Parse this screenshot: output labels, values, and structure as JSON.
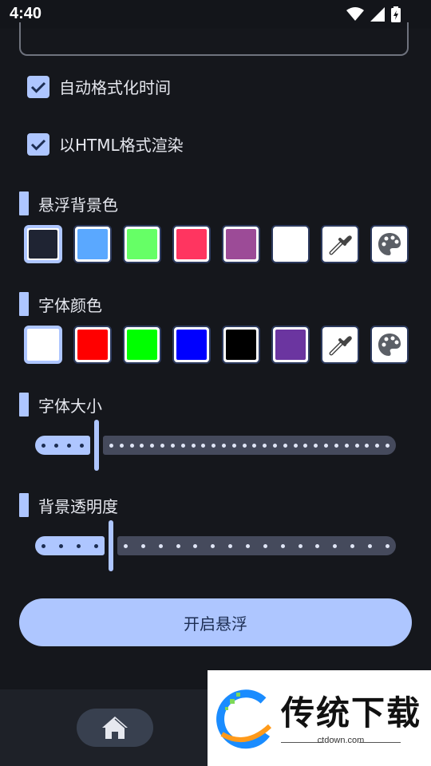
{
  "status_bar": {
    "time": "4:40"
  },
  "checkboxes": [
    {
      "label": "自动格式化时间",
      "checked": true
    },
    {
      "label": "以HTML格式渲染",
      "checked": true
    }
  ],
  "bg_color_section": {
    "title": "悬浮背景色",
    "swatches": [
      "#1f2433",
      "#5aa8ff",
      "#66ff66",
      "#ff3560",
      "#9c4b97",
      "#ffffff"
    ],
    "selected_index": 0
  },
  "font_color_section": {
    "title": "字体颜色",
    "swatches": [
      "#ffffff",
      "#ff0000",
      "#00ff00",
      "#0000ff",
      "#000000",
      "#6b35a0"
    ],
    "selected_index": 0
  },
  "font_size_section": {
    "title": "字体大小",
    "value_fraction": 0.17
  },
  "opacity_section": {
    "title": "背景透明度",
    "value_fraction": 0.21
  },
  "start_button": {
    "label": "开启悬浮"
  },
  "nav": {
    "home_icon": "home-icon"
  },
  "watermark": {
    "title": "传统下载",
    "subtitle": "ctdown.com"
  },
  "colors": {
    "accent": "#aec6ff",
    "background": "#15171c"
  }
}
